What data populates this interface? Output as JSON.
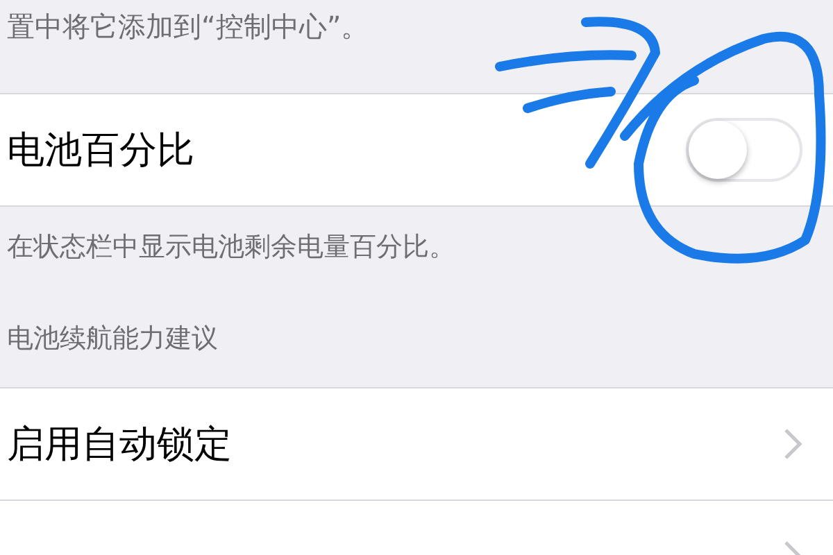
{
  "top_note": "置中将它添加到“控制中心”。",
  "battery_row": {
    "label": "电池百分比",
    "on": false
  },
  "battery_note": "在状态栏中显示电池剩余电量百分比。",
  "section_header": "电池续航能力建议",
  "rows": [
    {
      "label": "启用自动锁定",
      "kind": "full"
    },
    {
      "kind": "cut"
    }
  ]
}
